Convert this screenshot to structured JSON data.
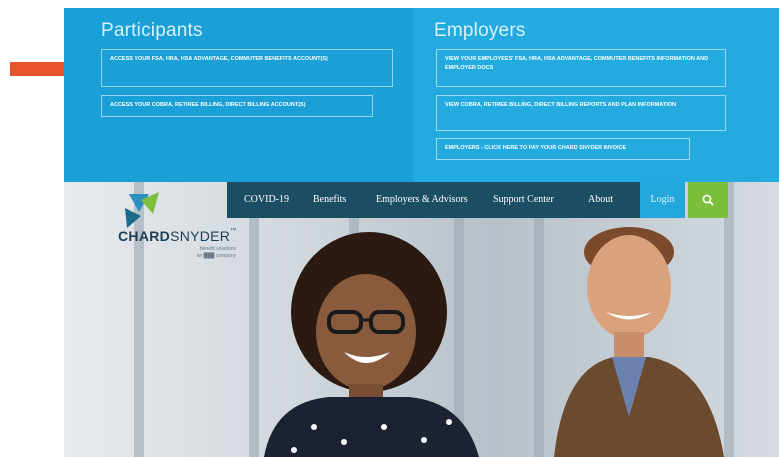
{
  "participants": {
    "title": "Participants",
    "links": [
      "ACCESS YOUR FSA, HRA, HSA ADVANTAGE, COMMUTER BENEFITS ACCOUNT(S)",
      "ACCESS YOUR COBRA, RETIREE BILLING, DIRECT BILLING ACCOUNT(S)"
    ]
  },
  "employers": {
    "title": "Employers",
    "links": [
      "VIEW YOUR EMPLOYEES' FSA, HRA, HSA ADVANTAGE, COMMUTER BENEFITS INFORMATION AND EMPLOYER DOCS",
      "VIEW COBRA, RETIREE BILLING, DIRECT BILLING REPORTS AND PLAN INFORMATION",
      "EMPLOYERS - CLICK HERE TO PAY YOUR CHARD SNYDER INVOICE"
    ]
  },
  "nav": {
    "items": [
      "COVID-19",
      "Benefits",
      "Employers & Advisors",
      "Support Center",
      "About"
    ],
    "login": "Login"
  },
  "logo": {
    "name_bold": "CHARD",
    "name_light": "SNYDER",
    "tm": "™",
    "tagline_1": "benefit solutions",
    "tagline_2": "an ███ company"
  },
  "colors": {
    "panel_blue": "#1aa0d6",
    "nav_navy": "#1c4e63",
    "search_green": "#7cbf3d",
    "arrow_orange": "#e8532a"
  },
  "icons": [
    "arrow-right-icon",
    "search-icon",
    "chardsnyder-logo-icon"
  ]
}
